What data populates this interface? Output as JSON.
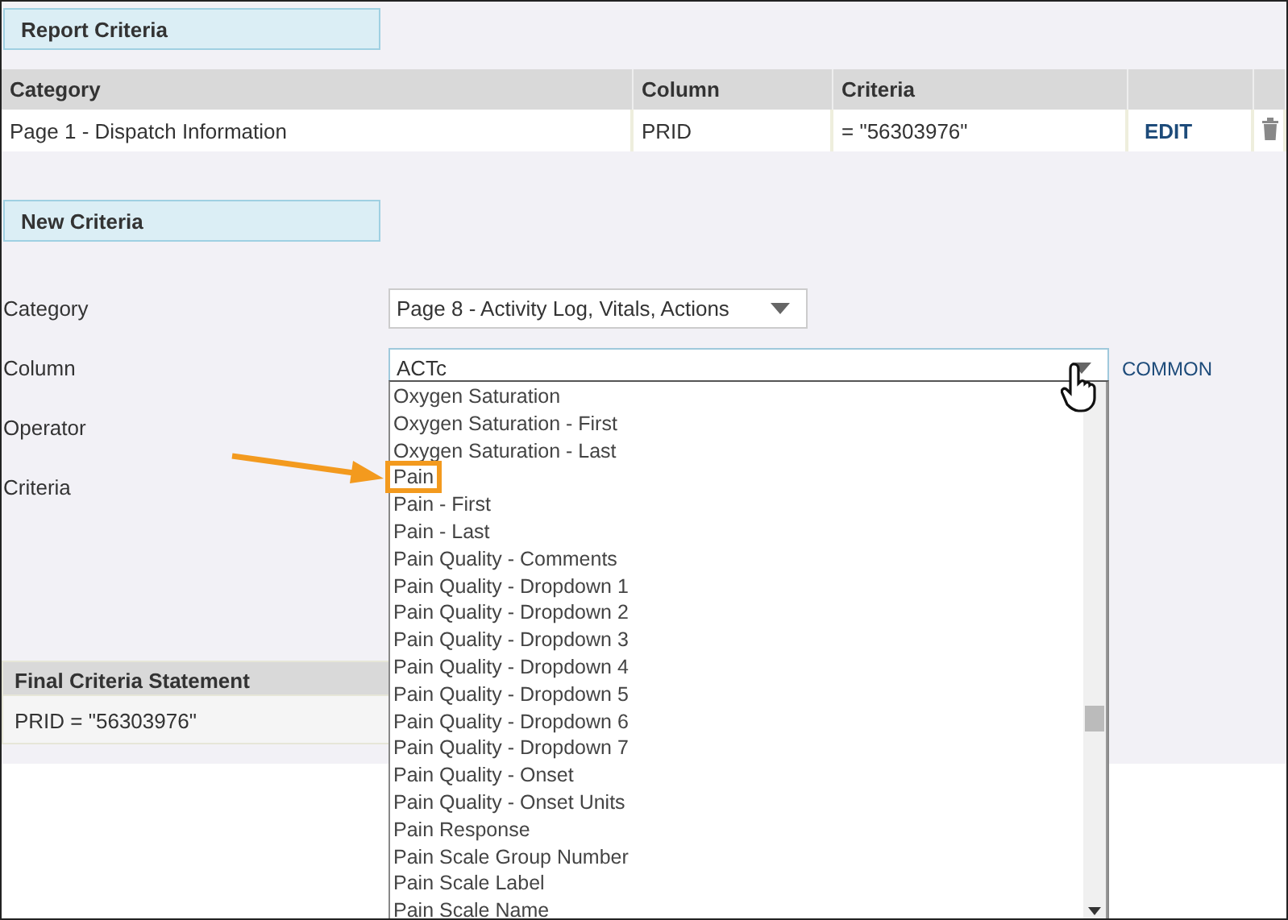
{
  "report_criteria": {
    "title": "Report Criteria",
    "columns": [
      "Category",
      "Column",
      "Criteria"
    ],
    "rows": [
      {
        "category": "Page 1 - Dispatch Information",
        "column": "PRID",
        "criteria": "= \"56303976\"",
        "action": "EDIT"
      }
    ]
  },
  "new_criteria": {
    "title": "New Criteria",
    "fields": [
      {
        "label": "Category",
        "kind": "select",
        "value": "Page 8 - Activity Log, Vitals, Actions",
        "open": false
      },
      {
        "label": "Column",
        "kind": "select",
        "value": "ACTc",
        "open": true,
        "note": "COMMON"
      },
      {
        "label": "Operator",
        "kind": "hidden"
      },
      {
        "label": "Criteria",
        "kind": "hidden"
      }
    ],
    "options": [
      {
        "label": "Oxygen Saturation",
        "highlighted": false
      },
      {
        "label": "Oxygen Saturation - First",
        "highlighted": false
      },
      {
        "label": "Oxygen Saturation - Last",
        "highlighted": false
      },
      {
        "label": "Pain",
        "highlighted": true
      },
      {
        "label": "Pain - First",
        "highlighted": false
      },
      {
        "label": "Pain - Last",
        "highlighted": false
      },
      {
        "label": "Pain Quality - Comments",
        "highlighted": false
      },
      {
        "label": "Pain Quality - Dropdown 1",
        "highlighted": false
      },
      {
        "label": "Pain Quality - Dropdown 2",
        "highlighted": false
      },
      {
        "label": "Pain Quality - Dropdown 3",
        "highlighted": false
      },
      {
        "label": "Pain Quality - Dropdown 4",
        "highlighted": false
      },
      {
        "label": "Pain Quality - Dropdown 5",
        "highlighted": false
      },
      {
        "label": "Pain Quality - Dropdown 6",
        "highlighted": false
      },
      {
        "label": "Pain Quality - Dropdown 7",
        "highlighted": false
      },
      {
        "label": "Pain Quality - Onset",
        "highlighted": false
      },
      {
        "label": "Pain Quality - Onset Units",
        "highlighted": false
      },
      {
        "label": "Pain Response",
        "highlighted": false
      },
      {
        "label": "Pain Scale Group Number",
        "highlighted": false
      },
      {
        "label": "Pain Scale Label",
        "highlighted": false
      },
      {
        "label": "Pain Scale Name",
        "highlighted": false
      }
    ]
  },
  "final_criteria": {
    "title": "Final Criteria Statement",
    "statement": "PRID = \"56303976\""
  }
}
